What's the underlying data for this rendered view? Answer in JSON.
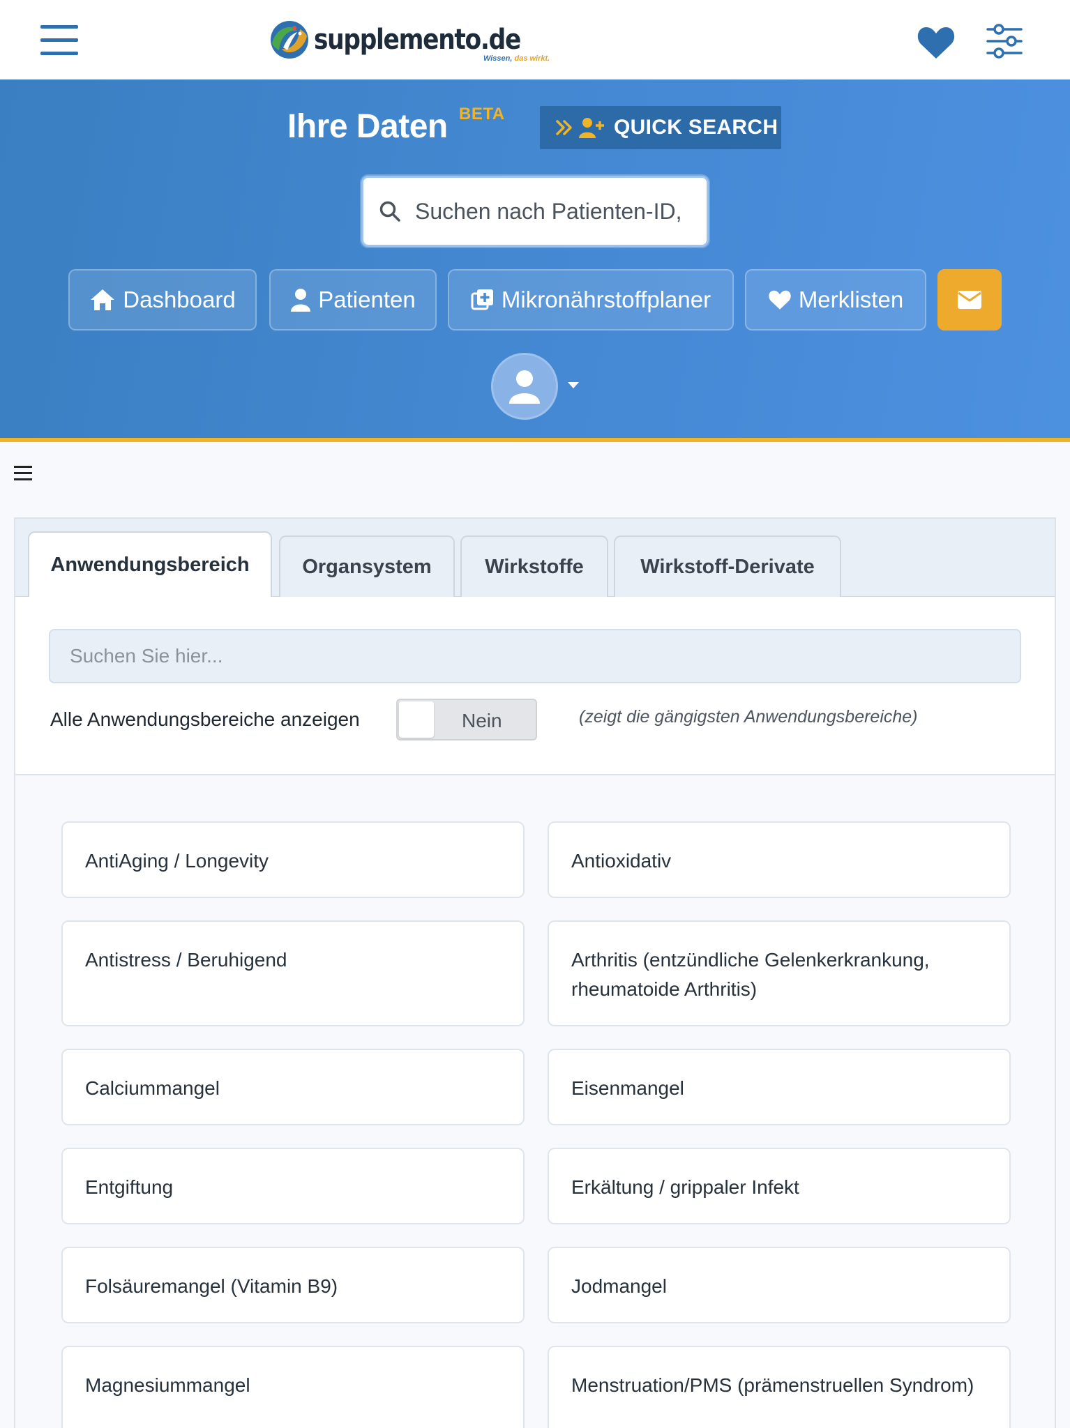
{
  "header": {
    "logo_name": "supplemento.de",
    "logo_tagline_part1": "Wissen, ",
    "logo_tagline_part2": "das wirkt."
  },
  "hero": {
    "title": "Ihre Daten",
    "beta_badge": "BETA",
    "quick_search_label": "QUICK SEARCH",
    "search_placeholder": "Suchen nach Patienten-ID,",
    "nav": {
      "dashboard": "Dashboard",
      "patients": "Patienten",
      "planner": "Mikronährstoffplaner",
      "lists": "Merklisten"
    }
  },
  "tabs": [
    "Anwendungsbereich",
    "Organsystem",
    "Wirkstoffe",
    "Wirkstoff-Derivate"
  ],
  "filter": {
    "placeholder": "Suchen Sie hier...",
    "toggle_label": "Alle Anwendungsbereiche anzeigen",
    "toggle_value": "Nein",
    "toggle_hint": "(zeigt die gängigsten Anwendungsbereiche)"
  },
  "items": [
    "AntiAging / Longevity",
    "Antioxidativ",
    "Antistress / Beruhigend",
    "Arthritis (entzündliche Gelenkerkrankung, rheumatoide Arthritis)",
    "Calciummangel",
    "Eisenmangel",
    "Entgiftung",
    "Erkältung / grippaler Infekt",
    "Folsäuremangel (Vitamin B9)",
    "Jodmangel",
    "Magnesiummangel",
    "Menstruation/PMS (prämenstruellen Syndrom)"
  ],
  "colors": {
    "hero_blue": "#3a7fc1",
    "accent_yellow": "#f0b429",
    "mail_button": "#eeaa2c",
    "quick_search_bg": "#2c6aa8"
  }
}
